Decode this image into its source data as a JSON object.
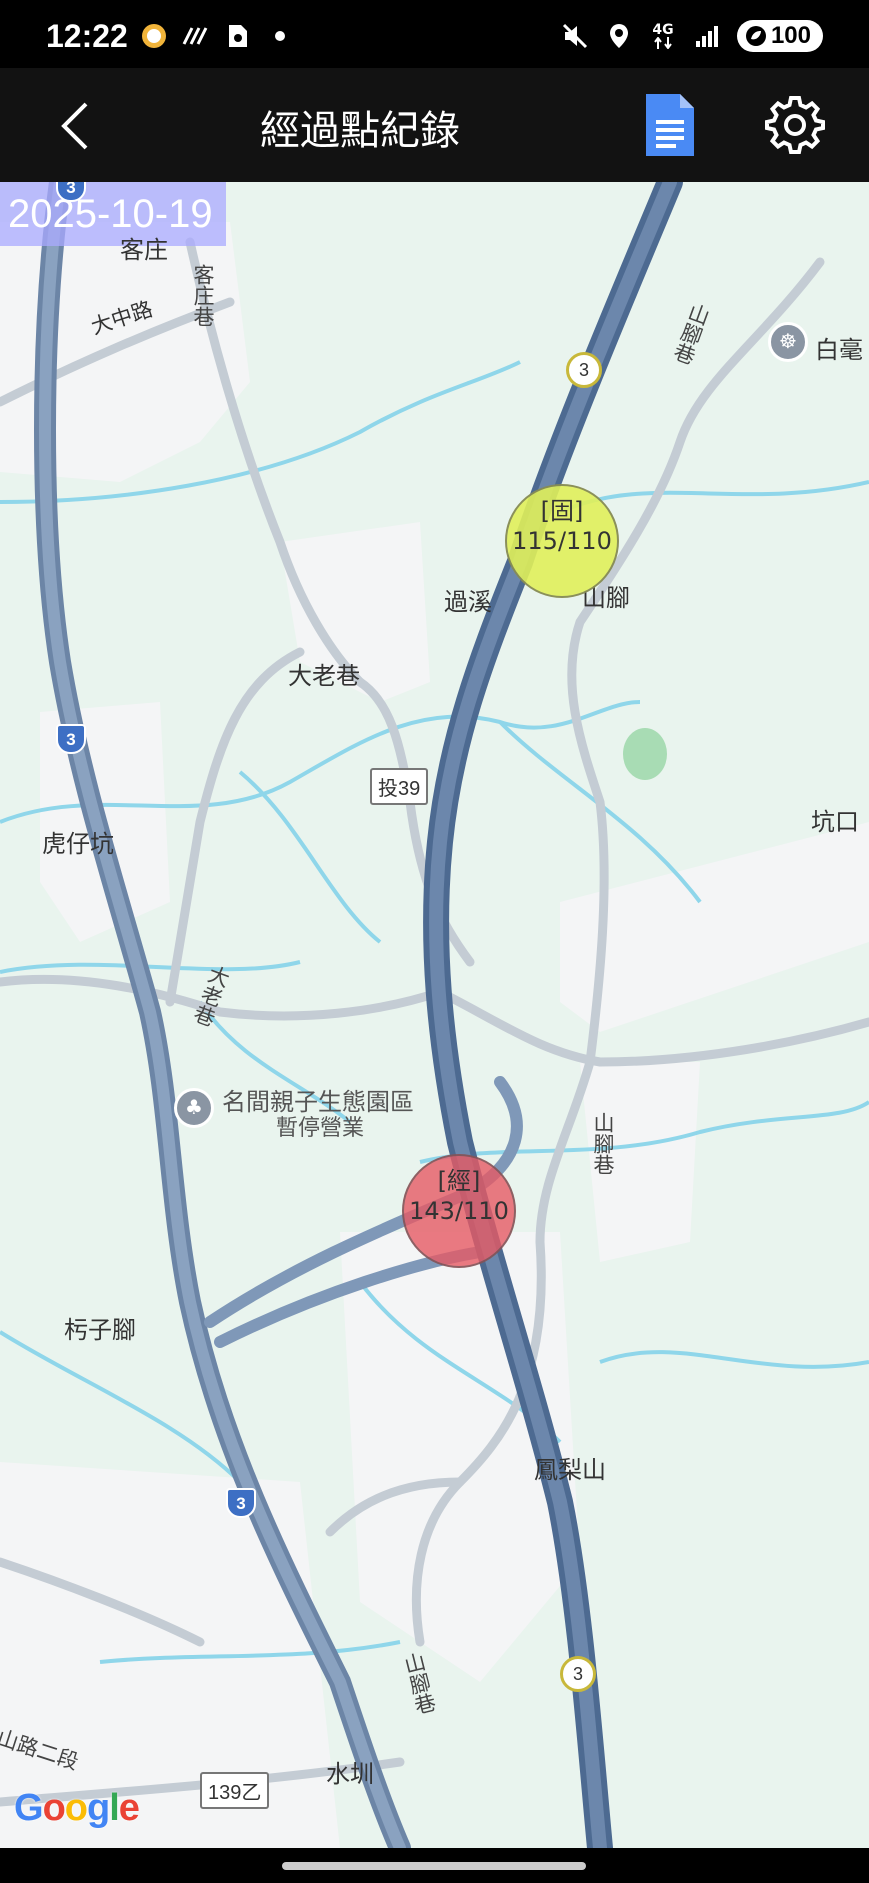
{
  "status_bar": {
    "time": "12:22",
    "network": "4G",
    "battery": "100",
    "icons": [
      "app-badge-icon",
      "signal-lines-icon",
      "sim-card-icon",
      "dot-icon",
      "mute-vibrate-icon",
      "location-icon",
      "data-arrows-icon",
      "cell-signal-icon",
      "battery-saver-icon"
    ]
  },
  "app_bar": {
    "title": "經過點紀錄",
    "icons": [
      "back-arrow-icon",
      "document-icon",
      "gear-icon"
    ]
  },
  "map": {
    "date": "2025-10-19",
    "places": [
      "客庄",
      "大中路",
      "客庄巷",
      "白毫",
      "過溪",
      "山腳",
      "大老巷",
      "虎仔坑",
      "大老巷",
      "名間親子生態園區",
      "暫停營業",
      "坑口",
      "山腳巷",
      "山腳巷",
      "杇子腳",
      "鳳梨山",
      "山腳巷",
      "山路二段",
      "水圳"
    ],
    "shields": {
      "route_39": "投39",
      "route_139": "139乙",
      "highway": "3"
    },
    "markers": [
      {
        "tag": "[固]",
        "count": "115/110",
        "color": "#e0f05a"
      },
      {
        "tag": "[經]",
        "count": "143/110",
        "color": "#e65a64"
      }
    ],
    "brand": [
      "G",
      "o",
      "o",
      "g",
      "l",
      "e"
    ],
    "brand_colors": [
      "#4285F4",
      "#EA4335",
      "#FBBC05",
      "#4285F4",
      "#34A853",
      "#EA4335"
    ]
  }
}
